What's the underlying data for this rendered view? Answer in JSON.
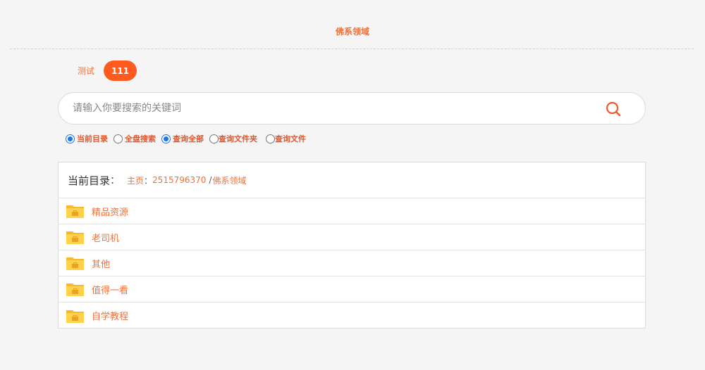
{
  "site_title": "佛系领域",
  "tabs": [
    {
      "label": "测试",
      "active": false
    },
    {
      "label": "111",
      "active": true
    }
  ],
  "search": {
    "placeholder": "请输入你要搜索的关键词",
    "value": "",
    "button_icon": "search-icon"
  },
  "search_modes": [
    {
      "label": "当前目录",
      "checked": true
    },
    {
      "label": "全盘搜索",
      "checked": false
    },
    {
      "label": "查询全部",
      "checked": true
    },
    {
      "label": "查询文件夹",
      "checked": false
    },
    {
      "label": "查询文件",
      "checked": false
    }
  ],
  "directory": {
    "label": "当前目录",
    "separator": "：",
    "breadcrumb": {
      "home": "主页",
      "home_sep": "：",
      "id": "2515796370",
      "slash": "/",
      "current": "佛系领域"
    },
    "folders": [
      {
        "name": "精品资源",
        "icon": "folder-icon"
      },
      {
        "name": "老司机",
        "icon": "folder-icon"
      },
      {
        "name": "其他",
        "icon": "folder-icon"
      },
      {
        "name": "值得一看",
        "icon": "folder-icon"
      },
      {
        "name": "自学教程",
        "icon": "folder-icon"
      }
    ]
  },
  "colors": {
    "accent": "#f0713a",
    "tab_active": "#ff5a1f",
    "radio": "#1a73e8",
    "folder": "#ffcd44"
  }
}
